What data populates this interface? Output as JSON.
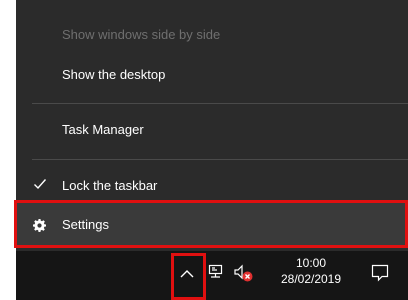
{
  "context_menu": {
    "items": [
      {
        "label": "Show windows side by side",
        "enabled": false
      },
      {
        "label": "Show the desktop",
        "enabled": true
      },
      {
        "label": "Task Manager",
        "enabled": true
      },
      {
        "label": "Lock the taskbar",
        "enabled": true,
        "checked": true
      },
      {
        "label": "Settings",
        "enabled": true,
        "icon": "gear-icon",
        "highlighted": true
      }
    ]
  },
  "taskbar": {
    "clock": {
      "time": "10:00",
      "date": "28/02/2019"
    },
    "tray_icons": [
      "show-hidden-icons-chevron-icon",
      "network-icon",
      "volume-muted-icon",
      "action-center-icon"
    ]
  },
  "colors": {
    "menu_background": "#2b2b2b",
    "taskbar_background": "#151515",
    "highlight_border": "#e01010",
    "disabled_text": "#6f6f6f"
  }
}
